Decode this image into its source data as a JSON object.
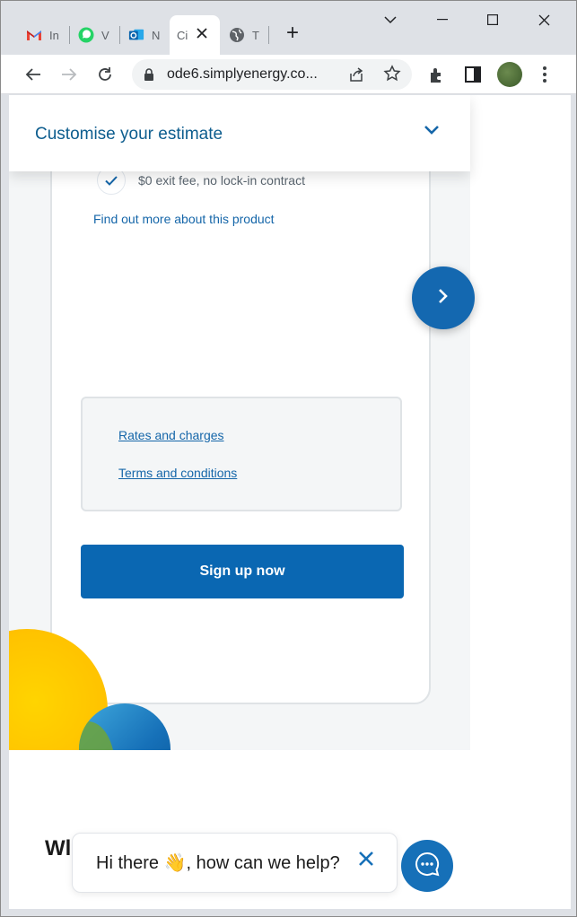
{
  "browser": {
    "tabs": [
      {
        "name": "gmail",
        "title": "In",
        "icon": "gmail-icon"
      },
      {
        "name": "whatsapp",
        "title": "V",
        "icon": "whatsapp-icon"
      },
      {
        "name": "outlook",
        "title": "N",
        "icon": "outlook-icon"
      },
      {
        "name": "current",
        "title": "Ci",
        "icon": "page-icon"
      },
      {
        "name": "web",
        "title": "T",
        "icon": "globe-icon"
      }
    ],
    "new_tab": "+",
    "url": "ode6.simplyenergy.co..."
  },
  "page": {
    "estimate_bar_label": "Customise your estimate",
    "feature_text": "$0 exit fee, no lock-in contract",
    "more_link": "Find out more about this product",
    "rates_link": "Rates and charges",
    "terms_link": "Terms and conditions",
    "signup_label": "Sign up now",
    "partial_heading": "Wl"
  },
  "chat": {
    "greeting": "Hi there 👋, how can we help?"
  },
  "colors": {
    "brand_blue": "#0a67b2",
    "link_blue": "#1566a9",
    "accent_yellow": "#ffc300"
  }
}
